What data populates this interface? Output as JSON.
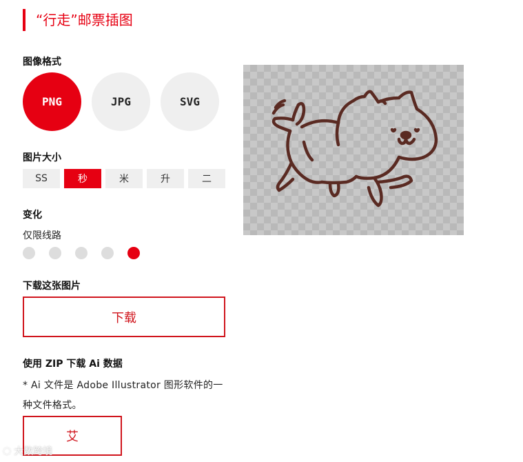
{
  "header": {
    "title": "“行走”邮票插图"
  },
  "format": {
    "label": "图像格式",
    "options": [
      "PNG",
      "JPG",
      "SVG"
    ],
    "selected": "PNG"
  },
  "size": {
    "label": "图片大小",
    "options": [
      "SS",
      "秒",
      "米",
      "升",
      "二"
    ],
    "selected": "秒"
  },
  "variation": {
    "label": "变化",
    "sublabel": "仅限线路",
    "selected_index": 5,
    "count": 5
  },
  "download": {
    "label": "下载这张图片",
    "button": "下载"
  },
  "zip": {
    "label": "使用 ZIP 下载 Ai 数据",
    "note": "* Ai 文件是 Adobe Illustrator 图形软件的一种文件格式。",
    "button": "艾"
  },
  "watermark": {
    "text": "大数跨境"
  },
  "colors": {
    "accent": "#e60012",
    "button_gray": "#efefef",
    "dot_gray": "#dddddd",
    "drawing_line": "#5a2a22"
  },
  "preview": {
    "icon": "walking-dog-illustration"
  }
}
